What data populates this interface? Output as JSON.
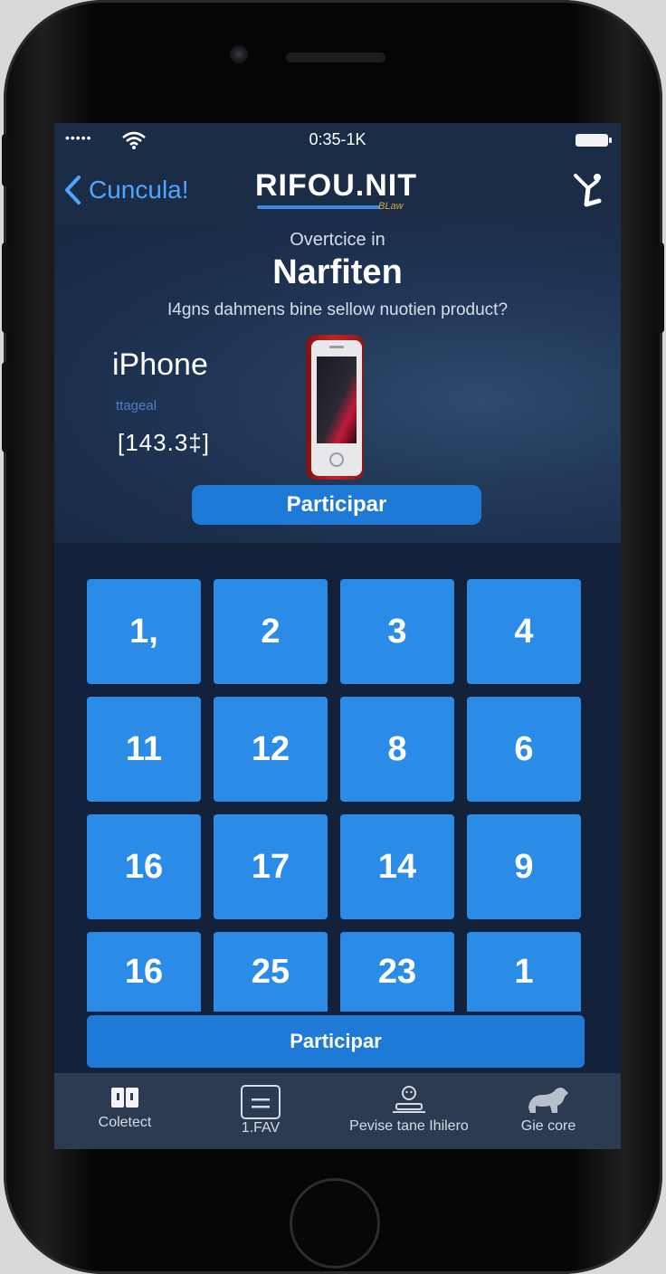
{
  "status_bar": {
    "signal": "•••••",
    "time": "0:35-1K"
  },
  "navbar": {
    "back_label": "Cuncula!",
    "logo_text": "RIFOU.NIT",
    "logo_sub": "BLaw"
  },
  "hero": {
    "overtitle": "Overtcice in",
    "headline": "Narfiten",
    "question": "I4gns dahmens bine sellow nuotien product?",
    "product_name": "iPhone",
    "product_tag": "ttageal",
    "product_price": "[143.3‡]",
    "button_label": "Participar"
  },
  "grid": {
    "numbers": [
      "1,",
      "2",
      "3",
      "4",
      "11",
      "12",
      "8",
      "6",
      "16",
      "17",
      "14",
      "9",
      "16",
      "25",
      "23",
      "1"
    ],
    "button_label": "Participar"
  },
  "tabbar": {
    "items": [
      {
        "label": "Coletect",
        "icon": "book-icon"
      },
      {
        "label": "1.FAV",
        "icon": "list-icon"
      },
      {
        "label": "Pevise tane Ihilero",
        "icon": "user-ticket-icon"
      },
      {
        "label": "Gie core",
        "icon": "animal-icon"
      }
    ]
  },
  "colors": {
    "accent": "#2b8ce8",
    "button": "#1f79d6",
    "link": "#4da6ff",
    "background": "#1c2a42"
  }
}
